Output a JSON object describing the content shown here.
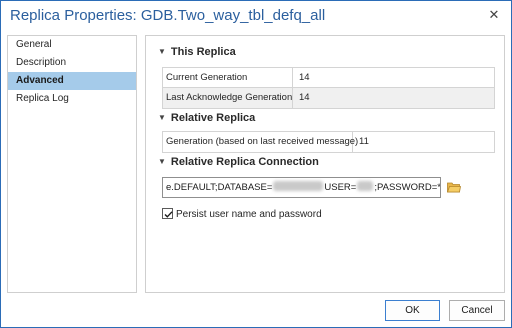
{
  "window": {
    "title": "Replica Properties: GDB.Two_way_tbl_defq_all",
    "close_glyph": "✕",
    "border_color": "#2b6cb7"
  },
  "nav": {
    "items": [
      {
        "label": "General"
      },
      {
        "label": "Description"
      },
      {
        "label": "Advanced"
      },
      {
        "label": "Replica Log"
      }
    ],
    "selected": "Advanced",
    "selected_color": "#a5cbea"
  },
  "this_replica": {
    "heading": "This Replica",
    "rows": [
      {
        "label": "Current Generation",
        "value": "14"
      },
      {
        "label": "Last Acknowledge Generation",
        "value": "14"
      }
    ]
  },
  "relative_replica": {
    "heading": "Relative Replica",
    "rows": [
      {
        "label": "Generation (based on last received message)",
        "value": "11"
      }
    ]
  },
  "relative_connection": {
    "heading": "Relative Replica Connection",
    "seg1": "e.DEFAULT;DATABASE=",
    "seg2": "USER=",
    "seg3": ";PASSWORD=******",
    "browse_icon": "folder-icon"
  },
  "persist": {
    "label": "Persist user name and password",
    "checked": true
  },
  "buttons": {
    "ok": "OK",
    "cancel": "Cancel"
  }
}
